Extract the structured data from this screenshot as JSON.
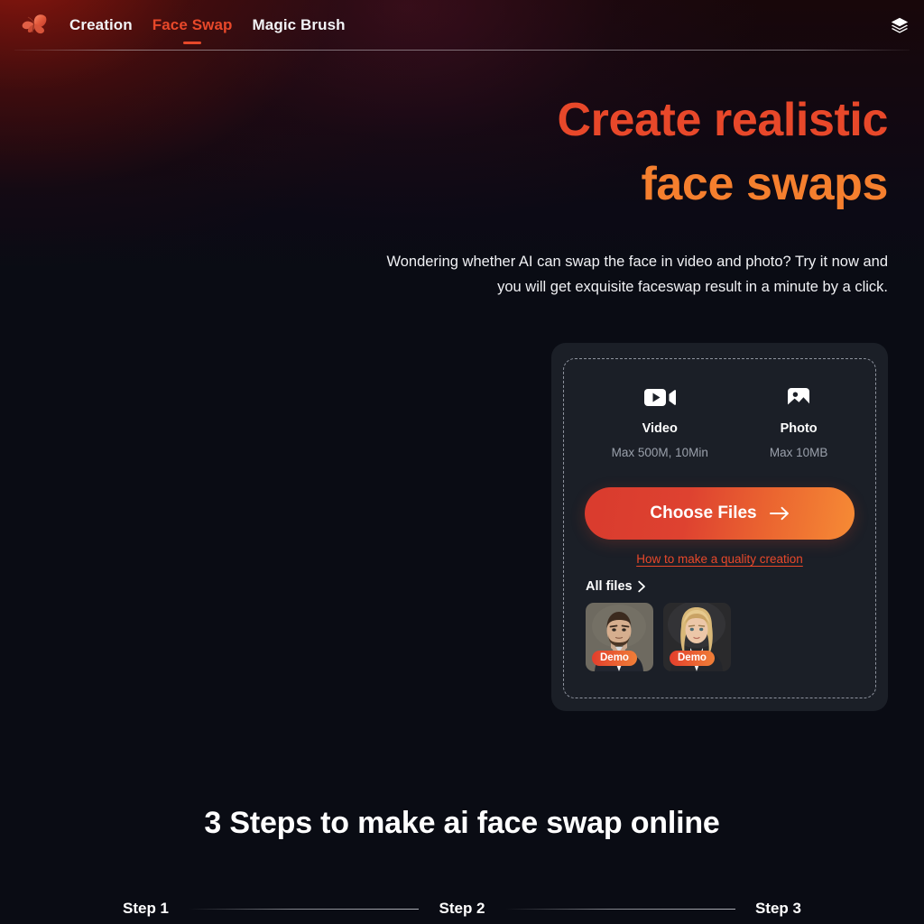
{
  "header": {
    "logo_icon": "butterfly-logo",
    "nav_items": [
      {
        "label": "Creation",
        "active": false
      },
      {
        "label": "Face Swap",
        "active": true
      },
      {
        "label": "Magic Brush",
        "active": false
      }
    ],
    "right_icon": "layers-icon"
  },
  "hero": {
    "title_line1": "Create realistic",
    "title_line2": "face swaps",
    "subtitle": "Wondering whether AI can swap the face in video and photo? Try it now and you will get exquisite faceswap result in a minute by a click."
  },
  "upload": {
    "media_types": [
      {
        "icon": "video-icon",
        "label": "Video",
        "note": "Max 500M, 10Min"
      },
      {
        "icon": "photo-icon",
        "label": "Photo",
        "note": "Max 10MB"
      }
    ],
    "choose_button_label": "Choose Files",
    "choose_button_icon": "arrow-right-icon",
    "quality_link_label": "How to make a quality creation",
    "all_files_label": "All files",
    "all_files_icon": "chevron-right-icon",
    "thumbnails": [
      {
        "name": "demo-male-portrait",
        "badge": "Demo"
      },
      {
        "name": "demo-female-portrait",
        "badge": "Demo"
      }
    ]
  },
  "steps_section": {
    "heading": "3 Steps to make ai face swap online",
    "steps": [
      {
        "label": "Step 1"
      },
      {
        "label": "Step 2"
      },
      {
        "label": "Step 3"
      }
    ]
  },
  "colors": {
    "accent_red": "#e8482a",
    "accent_orange": "#f57f2e",
    "page_background": "#0a0c14",
    "card_background": "#1b1f27",
    "dashed_border": "#8e939e",
    "muted_text": "#9aa0ab"
  }
}
